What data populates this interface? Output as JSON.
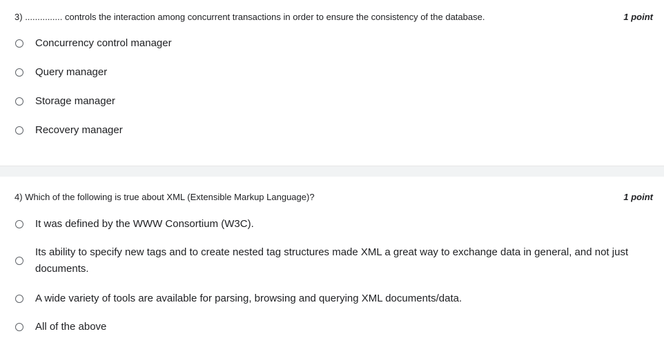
{
  "questions": [
    {
      "number": "3)",
      "text": "............... controls the interaction among concurrent transactions in order to ensure the consistency of the database.",
      "points": "1 point",
      "options": [
        "Concurrency control manager",
        "Query manager",
        "Storage manager",
        "Recovery manager"
      ]
    },
    {
      "number": "4)",
      "text": "Which of the following is true about XML (Extensible Markup Language)?",
      "points": "1 point",
      "options": [
        "It was defined by the WWW Consortium (W3C).",
        "Its ability to specify new tags and to create nested tag structures made XML a great way to exchange data in general, and not just documents.",
        "A wide variety of tools are available for parsing, browsing and querying XML documents/data.",
        "All of the above"
      ]
    }
  ]
}
